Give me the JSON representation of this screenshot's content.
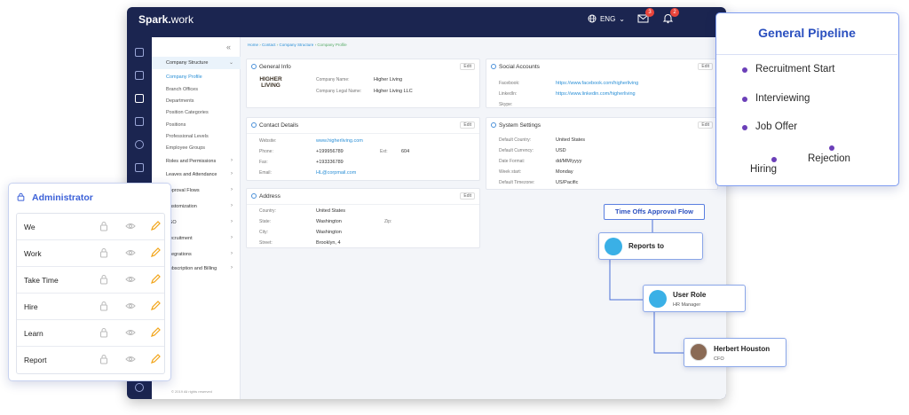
{
  "app": {
    "brand_bold": "Spark.",
    "brand_rest": "work",
    "language": "ENG",
    "mail_count": "3",
    "notif_count": "2"
  },
  "breadcrumb": [
    "Home",
    "Contact",
    "Company Structure",
    "Company Profile"
  ],
  "sidebar": {
    "section": "Company Structure",
    "subitems": [
      "Company Profile",
      "Branch Offices",
      "Departments",
      "Position Categories",
      "Positions",
      "Professional Levels",
      "Employee Groups"
    ],
    "items": [
      "Roles and Permissions",
      "Leaves and Attendance",
      "Approval Flows",
      "Customization",
      "SSO",
      "Recruitment",
      "Integrations",
      "Subscription and Billing"
    ],
    "footer": "© 2019 All rights reserved"
  },
  "general_info": {
    "title": "General Info",
    "edit": "Edit",
    "logo_text": "HIGHER LIVING",
    "company_name_label": "Company Name:",
    "company_name": "Higher Living",
    "legal_name_label": "Company Legal Name:",
    "legal_name": "Higher Living LLC"
  },
  "contact": {
    "title": "Contact Details",
    "edit": "Edit",
    "website_label": "Website:",
    "website": "www.higherliving.com",
    "phone_label": "Phone:",
    "phone": "+199956789",
    "ext_label": "Ext:",
    "ext": "604",
    "fax_label": "Fax:",
    "fax": "+193336789",
    "email_label": "Email:",
    "email": "HL@corpmail.com"
  },
  "address": {
    "title": "Address",
    "edit": "Edit",
    "country_label": "Country:",
    "country": "United States",
    "state_label": "State:",
    "state": "Washington",
    "zip_label": "Zip:",
    "city_label": "City:",
    "city": "Washington",
    "street_label": "Street:",
    "street": "Brooklyn, 4"
  },
  "social": {
    "title": "Social Accounts",
    "edit": "Edit",
    "facebook_label": "Facebook:",
    "facebook": "https://www.facebook.com/higherliving",
    "linkedin_label": "LinkedIn:",
    "linkedin": "https://www.linkedin.com/higherliving",
    "skype_label": "Skype:"
  },
  "system": {
    "title": "System Settings",
    "edit": "Edit",
    "country_label": "Default Country:",
    "country": "United States",
    "currency_label": "Default Currency:",
    "currency": "USD",
    "date_label": "Date Format:",
    "date": "dd/MM/yyyy",
    "week_label": "Week start:",
    "week": "Monday",
    "tz_label": "Default Timezone:",
    "tz": "US/Pacific"
  },
  "admin": {
    "title": "Administrator",
    "rows": [
      "We",
      "Work",
      "Take Time",
      "Hire",
      "Learn",
      "Report"
    ]
  },
  "pipeline": {
    "title": "General Pipeline",
    "items": [
      "Recruitment Start",
      "Interviewing",
      "Job Offer",
      "Hiring",
      "Rejection"
    ]
  },
  "flow": {
    "tag": "Time Offs Approval Flow",
    "reports_to": "Reports to",
    "user_role": "User Role",
    "user_role_sub": "HR Manager",
    "person": "Herbert Houston",
    "person_sub": "CFO"
  },
  "colors": {
    "navy": "#1b2550",
    "accent": "#2a4fbf",
    "link": "#2a8fd6",
    "pencil": "#f2a51a"
  }
}
